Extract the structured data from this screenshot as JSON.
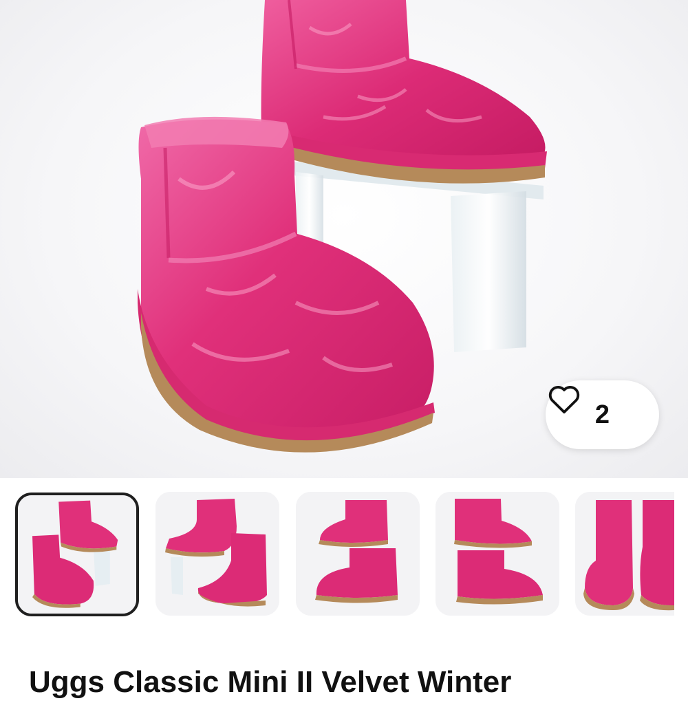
{
  "product": {
    "title": "Uggs Classic Mini II Velvet Winter",
    "likes": "2"
  },
  "icons": {
    "like": "heart-outline-icon"
  },
  "colors": {
    "velvet_pink": "#e0307a",
    "velvet_highlight": "#f07aae",
    "sole_tan": "#b58a5a",
    "acrylic_stand": "#d9e4ea"
  },
  "gallery": {
    "count": 5,
    "selected_index": 0
  }
}
